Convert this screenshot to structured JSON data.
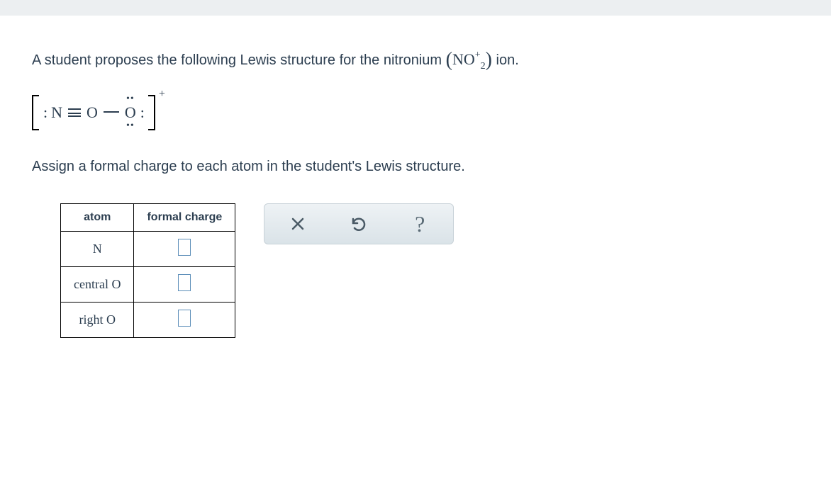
{
  "prompt1_prefix": "A student proposes the following Lewis structure for the nitronium ",
  "prompt1_suffix": " ion.",
  "formula": {
    "base": "NO",
    "sub": "2",
    "sup": "+"
  },
  "lewis": {
    "left_lone_pair": ":",
    "atom1": "N",
    "atom2": "O",
    "atom3": "O",
    "right_lone_pair": ":",
    "atom3_top_dots": "••",
    "atom3_bottom_dots": "••",
    "charge": "+"
  },
  "prompt2": "Assign a formal charge to each atom in the student's Lewis structure.",
  "table": {
    "headers": {
      "col1": "atom",
      "col2": "formal charge"
    },
    "rows": [
      {
        "atom": "N"
      },
      {
        "atom": "central O"
      },
      {
        "atom": "right O"
      }
    ]
  },
  "toolbar": {
    "clear": "clear",
    "reset": "reset",
    "help": "help"
  }
}
